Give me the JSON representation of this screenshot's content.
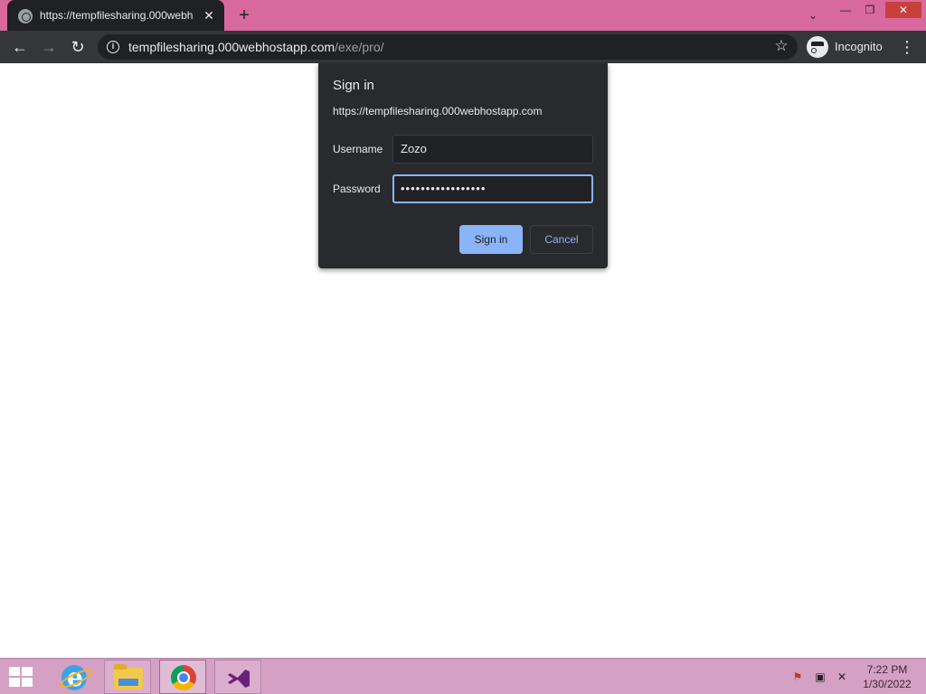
{
  "browser": {
    "tab": {
      "title": "https://tempfilesharing.000webh",
      "close_glyph": "✕"
    },
    "new_tab_glyph": "+",
    "window_controls": {
      "dropdown": "⌄",
      "minimize": "—",
      "maximize": "❐",
      "close": "✕"
    },
    "nav": {
      "back": "←",
      "forward": "→",
      "reload": "↻"
    },
    "address": {
      "host": "tempfilesharing.000webhostapp.com",
      "path": "/exe/pro/",
      "info_glyph": "i"
    },
    "bookmark_glyph": "☆",
    "incognito_label": "Incognito",
    "menu_glyph": "⋮"
  },
  "dialog": {
    "title": "Sign in",
    "origin": "https://tempfilesharing.000webhostapp.com",
    "username_label": "Username",
    "username_value": "Zozo",
    "password_label": "Password",
    "password_value": "•••••••••••••••••",
    "signin_label": "Sign in",
    "cancel_label": "Cancel"
  },
  "taskbar": {
    "tray": {
      "flag_glyph": "⚑",
      "network_glyph": "▣",
      "volume_glyph": "✕"
    },
    "time": "7:22 PM",
    "date": "1/30/2022"
  },
  "colors": {
    "tab_strip": "#d8699f",
    "toolbar": "#35363a",
    "dialog_bg": "#292a2d",
    "accent": "#8ab4f8",
    "taskbar": "#d4a0c3"
  },
  "icons": [
    "globe-icon",
    "info-icon",
    "star-icon",
    "incognito-icon",
    "menu-icon",
    "windows-start-icon",
    "internet-explorer-icon",
    "file-explorer-icon",
    "chrome-icon",
    "visual-studio-icon",
    "action-center-flag-icon",
    "network-icon",
    "volume-muted-icon"
  ]
}
